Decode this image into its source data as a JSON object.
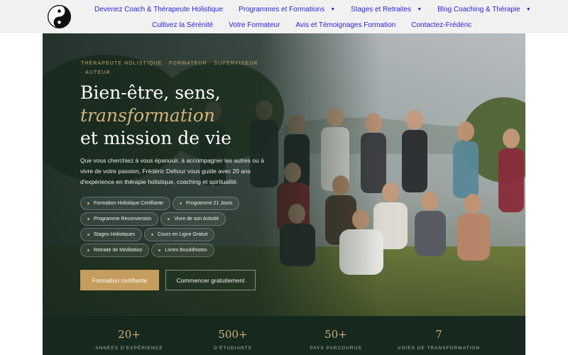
{
  "nav": {
    "logo_icon": "yin-yang-icon",
    "row1": [
      {
        "label": "Devenez Coach & Thérapeute Holistique",
        "dropdown": false
      },
      {
        "label": "Programmes et Formations",
        "dropdown": true
      },
      {
        "label": "Stages et Retraites",
        "dropdown": true
      },
      {
        "label": "Blog Coaching & Thérapie",
        "dropdown": true
      }
    ],
    "row2": [
      {
        "label": "Cultivez la Sérénité"
      },
      {
        "label": "Votre Formateur"
      },
      {
        "label": "Avis et Témoignages Formation"
      },
      {
        "label": "Contactez-Frédéric"
      }
    ],
    "caret_glyph": "▼"
  },
  "hero": {
    "kicker": "Thérapeute holistique · Formateur · Superviseur · Auteur",
    "headline_line1": "Bien-être, sens,",
    "headline_accent": "transformation",
    "headline_line3": "et mission de vie",
    "intro": "Que vous cherchiez à vous épanouir, à accompagner les autres ou à vivre de votre passion, Frédéric Deltour vous guide avec 20 ans d'expérience en thérapie holistique, coaching et spiritualité.",
    "tags": [
      "Formation Holistique Certifiante",
      "Programme 21 Jours",
      "Programme Reconversion",
      "Vivre de son Activité",
      "Stages Holistiques",
      "Cours en Ligne Gratuit",
      "Retraite de Méditation",
      "Livres Bouddhistes"
    ],
    "cta_primary": "Formation certifiante",
    "cta_secondary": "Commencer gratuitement"
  },
  "stats": [
    {
      "value": "20+",
      "label": "Années d'expérience"
    },
    {
      "value": "500+",
      "label": "d'étudiants"
    },
    {
      "value": "50+",
      "label": "Pays parcourus"
    },
    {
      "value": "7",
      "label": "Voies de transformation"
    }
  ],
  "colors": {
    "nav_link": "#2a1fd6",
    "gold": "#c59d5f",
    "hero_overlay": "#16281e",
    "stats_bg": "#16291f"
  }
}
